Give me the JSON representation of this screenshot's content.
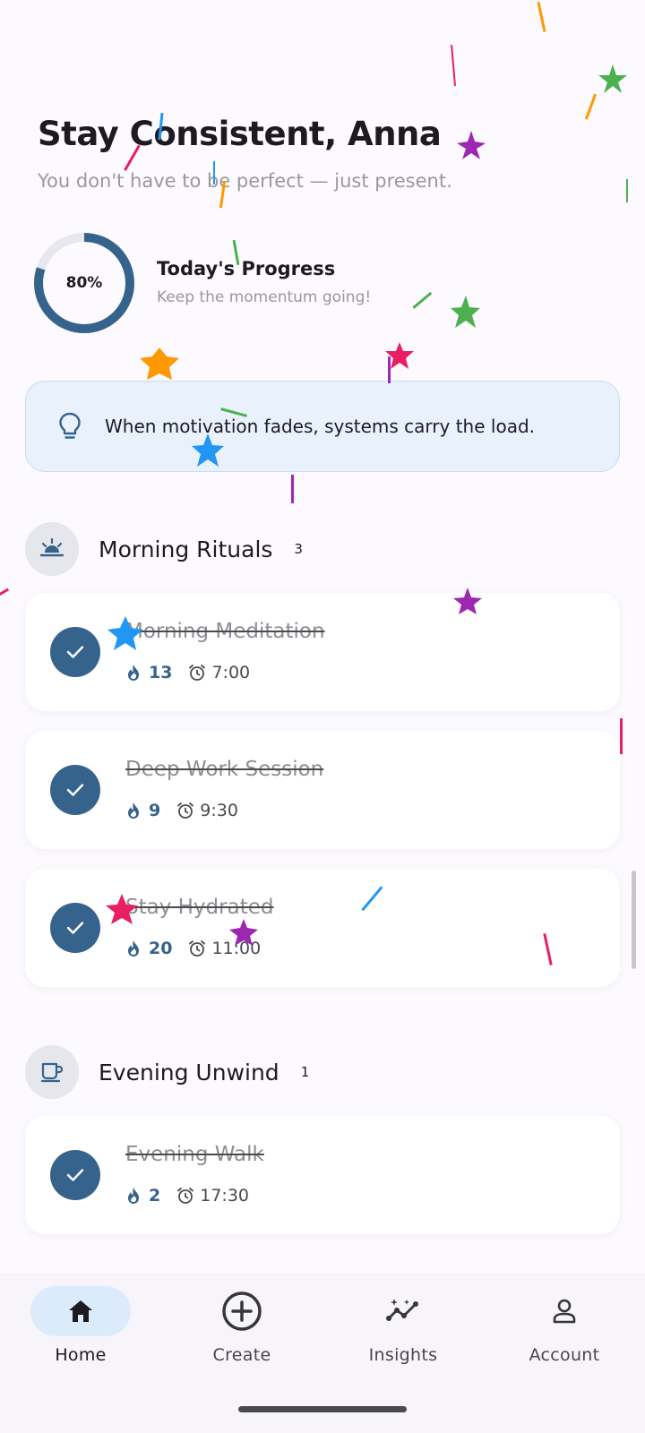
{
  "header": {
    "greeting": "Stay Consistent, Anna",
    "subtitle": "You don't have to be perfect — just present."
  },
  "progress": {
    "percent_label": "80%",
    "percent_value": 0.8,
    "title": "Today's Progress",
    "subtitle": "Keep the momentum going!"
  },
  "tip": {
    "icon": "lightbulb-icon",
    "text": "When motivation fades, systems carry the load."
  },
  "sections": [
    {
      "icon": "sunrise-icon",
      "title": "Morning Rituals",
      "count": "3",
      "habits": [
        {
          "name": "Morning Meditation",
          "streak": "13",
          "time": "7:00",
          "done": true
        },
        {
          "name": "Deep Work Session",
          "streak": "9",
          "time": "9:30",
          "done": true
        },
        {
          "name": "Stay Hydrated",
          "streak": "20",
          "time": "11:00",
          "done": true
        }
      ]
    },
    {
      "icon": "cup-icon",
      "title": "Evening Unwind",
      "count": "1",
      "habits": [
        {
          "name": "Evening Walk",
          "streak": "2",
          "time": "17:30",
          "done": true
        }
      ]
    }
  ],
  "nav": {
    "items": [
      {
        "label": "Home",
        "icon": "home-icon",
        "active": true
      },
      {
        "label": "Create",
        "icon": "add-circle-icon",
        "active": false
      },
      {
        "label": "Insights",
        "icon": "insights-icon",
        "active": false
      },
      {
        "label": "Account",
        "icon": "person-icon",
        "active": false
      }
    ]
  },
  "colors": {
    "accent": "#36638c",
    "tip_background": "#e8f1fc",
    "nav_active": "#dcebfb",
    "confetti": [
      "#4caf50",
      "#ff9800",
      "#2196f3",
      "#e91e63",
      "#9c27b0"
    ]
  }
}
